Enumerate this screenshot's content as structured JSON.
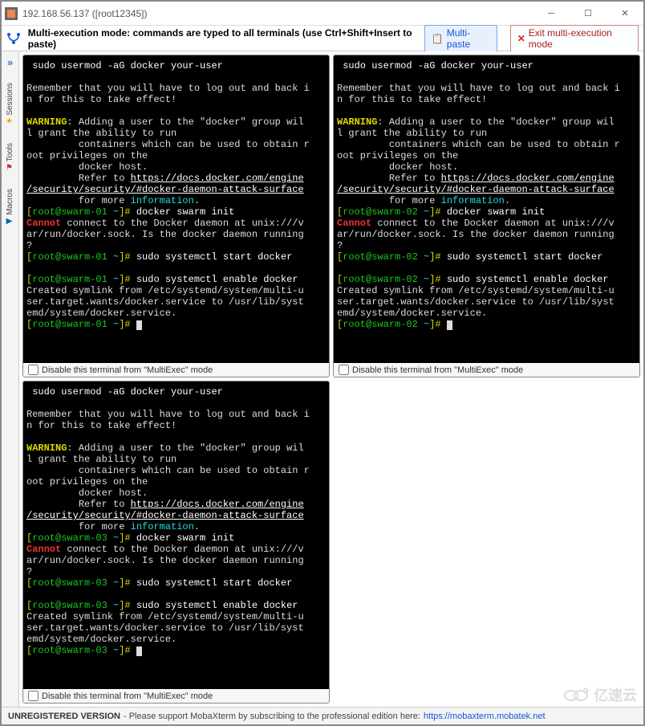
{
  "window": {
    "title": "192.168.56.137 ([root12345])"
  },
  "toolbar": {
    "message": "Multi-execution mode: commands are typed to all terminals (use Ctrl+Shift+Insert to paste)",
    "multipaste_label": "Multi-paste",
    "exit_label": "Exit multi-execution mode"
  },
  "sidebar": {
    "tabs": [
      "Sessions",
      "Tools",
      "Macros"
    ]
  },
  "terminals": [
    {
      "host": "swarm-01"
    },
    {
      "host": "swarm-02"
    },
    {
      "host": "swarm-03"
    }
  ],
  "terminal_shared": {
    "cmd_usermod": " sudo usermod -aG docker your-user",
    "remember_l1": "Remember that you will have to log out and back i",
    "remember_l2": "n for this to take effect!",
    "warning_label": "WARNING",
    "warn_l1": ": Adding a user to the \"docker\" group wil",
    "warn_l2": "l grant the ability to run",
    "warn_l3": "         containers which can be used to obtain r",
    "warn_l4": "oot privileges on the",
    "warn_l5": "         docker host.",
    "refer_prefix": "         Refer to ",
    "link_l1": "https://docs.docker.com/engine",
    "link_l2": "/security/security/#docker-daemon-attack-surface",
    "more_prefix": "         for more ",
    "more_info": "information",
    "more_suffix": ".",
    "cmd_swarm_init": "docker swarm init",
    "cannot_label": "Cannot",
    "cannot_l1": " connect to the Docker daemon at unix:///v",
    "cannot_l2": "ar/run/docker.sock. Is the docker daemon running",
    "cannot_l3": "?",
    "cmd_start": "sudo systemctl start docker",
    "cmd_enable": "sudo systemctl enable docker",
    "created_l1": "Created symlink from /etc/systemd/system/multi-u",
    "created_l2": "ser.target.wants/docker.service to /usr/lib/syst",
    "created_l3": "emd/system/docker.service."
  },
  "pane_footer": {
    "disable_label": "Disable this terminal from \"MultiExec\" mode"
  },
  "statusbar": {
    "unreg": "UNREGISTERED VERSION",
    "msg": " - Please support MobaXterm by subscribing to the professional edition here: ",
    "link": "https://mobaxterm.mobatek.net"
  },
  "watermark": {
    "text": "亿速云"
  }
}
